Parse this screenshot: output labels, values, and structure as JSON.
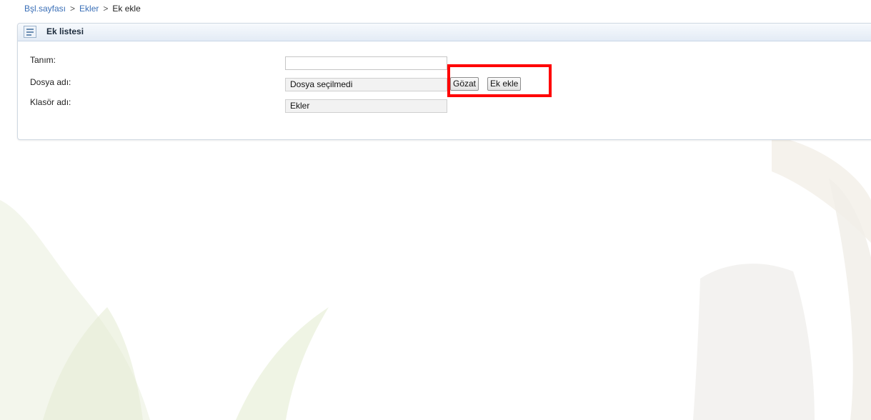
{
  "breadcrumb": {
    "home": "Bşl.sayfası",
    "separator": ">",
    "section": "Ekler",
    "current": "Ek ekle"
  },
  "panel": {
    "title": "Ek listesi",
    "icon": "list-icon"
  },
  "form": {
    "description_label": "Tanım:",
    "description_value": "",
    "file_label": "Dosya adı:",
    "file_value": "Dosya seçilmedi",
    "browse_button": "Gözat",
    "add_button": "Ek ekle",
    "folder_label": "Klasör adı:",
    "folder_value": "Ekler"
  },
  "colors": {
    "link": "#3a6fb7",
    "highlight": "#ff0000",
    "panel_border": "#cfd8e2",
    "header_gradient_end": "#e3ebf5"
  }
}
